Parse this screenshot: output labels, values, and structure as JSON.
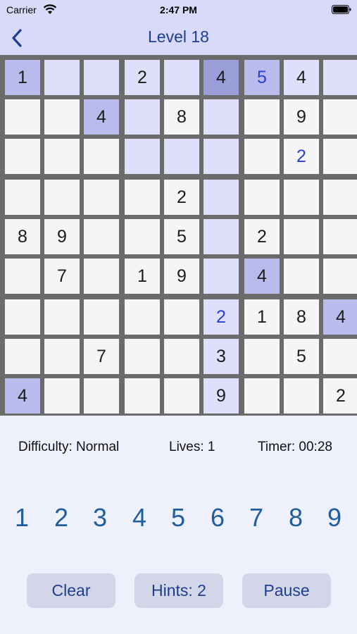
{
  "status_bar": {
    "carrier": "Carrier",
    "time": "2:47 PM"
  },
  "nav": {
    "title": "Level 18"
  },
  "board": {
    "cells": [
      [
        "1",
        "",
        "",
        "2",
        "",
        "4",
        "5",
        "4",
        ""
      ],
      [
        "",
        "",
        "4",
        "",
        "8",
        "",
        "",
        "9",
        ""
      ],
      [
        "",
        "",
        "",
        "",
        "",
        "",
        "",
        "2",
        ""
      ],
      [
        "",
        "",
        "",
        "",
        "2",
        "",
        "",
        "",
        ""
      ],
      [
        "8",
        "9",
        "",
        "",
        "5",
        "",
        "2",
        "",
        ""
      ],
      [
        "",
        "7",
        "",
        "1",
        "9",
        "",
        "4",
        "",
        ""
      ],
      [
        "",
        "",
        "",
        "",
        "",
        "2",
        "1",
        "8",
        "4"
      ],
      [
        "",
        "",
        "7",
        "",
        "",
        "3",
        "",
        "5",
        ""
      ],
      [
        "4",
        "",
        "",
        "",
        "",
        "9",
        "",
        "",
        "2"
      ]
    ],
    "highlight": [
      "MLLLLSMLL",
      "WWMLWLWWW",
      "WWWLLLWWW",
      "WWWWWLWWW",
      "WWWWWLWWW",
      "WWWWWLMWW",
      "WWWWWLWWM",
      "WWWWWLWWW",
      "MWWWWLWWW"
    ],
    "entry_state": [
      "....E.P..",
      ".........",
      ".......P.",
      ".........",
      ".........",
      ".........",
      ".....P...",
      ".........",
      "........."
    ],
    "colors": {
      "W": "#f5f5f8",
      "L": "#dedffa",
      "M": "#b8bbec",
      "S": "#9a9ed8",
      "given_digit": "#1c1c1c",
      "player_digit": "#2a3fd0",
      "error_digit": "#e02020"
    }
  },
  "info": {
    "difficulty": "Difficulty: Normal",
    "lives": "Lives: 1",
    "timer": "Timer: 00:28"
  },
  "numpad": [
    "1",
    "2",
    "3",
    "4",
    "5",
    "6",
    "7",
    "8",
    "9"
  ],
  "buttons": {
    "clear": "Clear",
    "hints": "Hints: 2",
    "pause": "Pause"
  }
}
